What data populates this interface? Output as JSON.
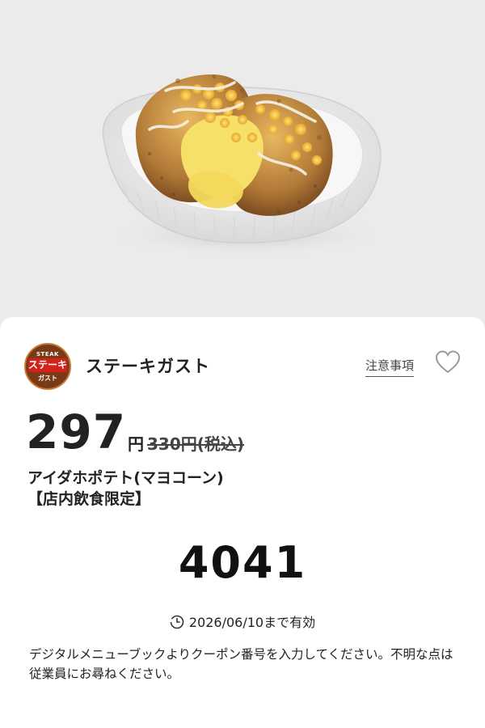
{
  "brand": {
    "name": "ステーキガスト",
    "logo_top": "STEAK",
    "logo_mid": "ステーキ",
    "logo_bottom": "ガスト"
  },
  "links": {
    "notes": "注意事項"
  },
  "icons": {
    "favorite": "heart-outline-icon",
    "expiry": "clock-icon"
  },
  "price": {
    "amount": "297",
    "currency": "円",
    "original": "330円(税込)"
  },
  "product": {
    "name": "アイダホポテト(マヨコーン)",
    "note": "【店内飲食限定】"
  },
  "coupon": {
    "code": "4041"
  },
  "expiry": {
    "text": "2026/06/10まで有効"
  },
  "instruction": "デジタルメニューブックよりクーポン番号を入力してください。不明な点は従業員にお尋ねください。",
  "colors": {
    "logo_bg": "#7a3a17",
    "logo_band": "#d4221a",
    "hero_bg": "#ebebeb"
  }
}
